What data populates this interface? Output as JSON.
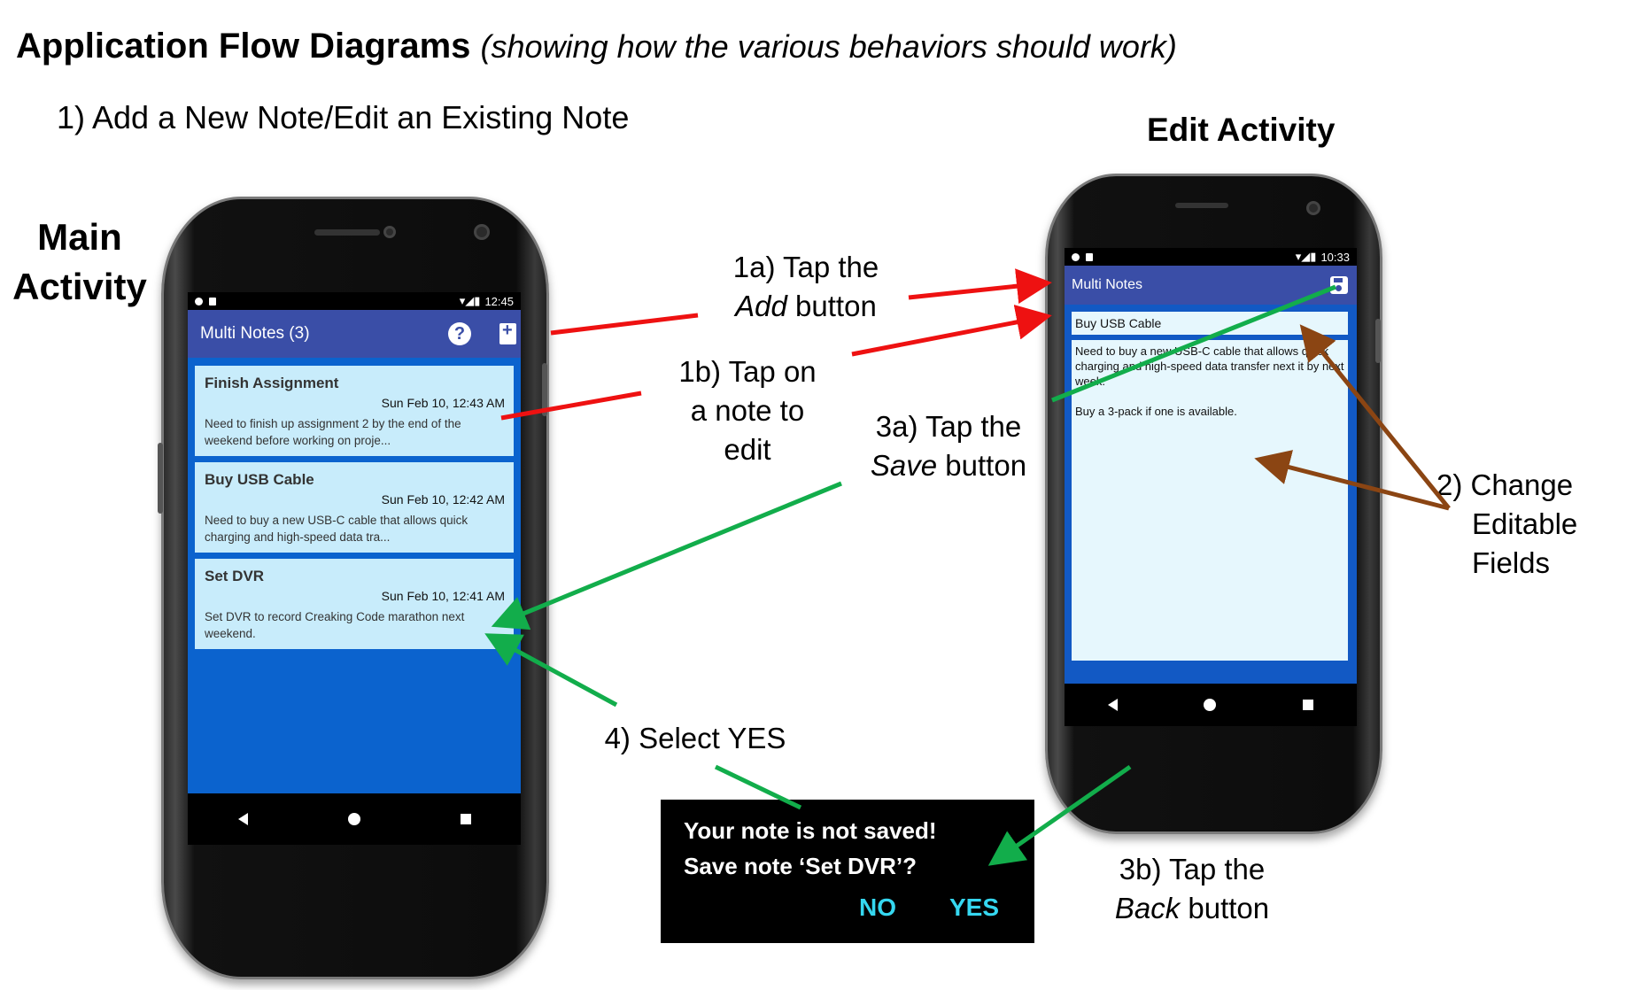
{
  "header": {
    "title": "Application Flow Diagrams",
    "subtitle": "(showing how the various behaviors should work)",
    "section": "1)   Add a New Note/Edit an Existing Note"
  },
  "labels": {
    "main_line1": "Main",
    "main_line2": "Activity",
    "edit": "Edit Activity"
  },
  "main_phone": {
    "status_time": "12:45",
    "app_title": "Multi Notes (3)",
    "help_glyph": "?",
    "notes": [
      {
        "title": "Finish Assignment",
        "date": "Sun Feb 10, 12:43 AM",
        "body": "Need to finish up assignment 2 by the end of the weekend before working on proje..."
      },
      {
        "title": "Buy USB Cable",
        "date": "Sun Feb 10, 12:42 AM",
        "body": "Need to buy a new USB-C cable that allows quick charging and high-speed data tra..."
      },
      {
        "title": "Set DVR",
        "date": "Sun Feb 10, 12:41 AM",
        "body": "Set DVR to record Creaking Code marathon next weekend."
      }
    ]
  },
  "edit_phone": {
    "status_time": "10:33",
    "app_title": "Multi Notes",
    "note_title": "Buy USB Cable",
    "note_body_p1": "Need to buy a new USB-C cable that allows quick charging and high-speed data transfer next it by next week.",
    "note_body_p2": "Buy a 3-pack if one is available."
  },
  "annotations": {
    "a1a_l1": "1a) Tap the",
    "a1a_l2_em": "Add",
    "a1a_l2_rest": " button",
    "a1b_l1": "1b) Tap on",
    "a1b_l2": "a note to",
    "a1b_l3": "edit",
    "a3a_l1": "3a) Tap the",
    "a3a_l2_em": "Save",
    "a3a_l2_rest": " button",
    "a2_l1": "2) Change",
    "a2_l2": "Editable",
    "a2_l3": "Fields",
    "a4": "4) Select YES",
    "a3b_l1": "3b) Tap the",
    "a3b_l2_em": "Back",
    "a3b_l2_rest": " button"
  },
  "dialog": {
    "line1": "Your note is not saved!",
    "line2": "Save note ‘Set DVR’?",
    "no": "NO",
    "yes": "YES"
  },
  "colors": {
    "red_arrow": "#ee1111",
    "green_arrow": "#12ad4b",
    "brown_arrow": "#8b4513",
    "dialog_button": "#35d7f0"
  }
}
